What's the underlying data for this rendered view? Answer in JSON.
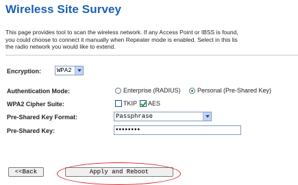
{
  "page": {
    "title": "Wireless Site Survey",
    "description_lines": [
      "This page provides tool to scan the wireless network. If any Access Point or IBSS is found,",
      "you could choose to connect it manually when Repeater mode is enabled. Select in this lis",
      "the radio network you would like to extend."
    ]
  },
  "form": {
    "encryption": {
      "label": "Encryption:",
      "value": "WPA2"
    },
    "auth_mode": {
      "label": "Authentication Mode:",
      "options": [
        {
          "label": "Enterprise (RADIUS)",
          "selected": false
        },
        {
          "label": "Personal (Pre-Shared Key)",
          "selected": true
        }
      ]
    },
    "cipher_suite": {
      "label": "WPA2 Cipher Suite:",
      "options": [
        {
          "label": "TKIP",
          "checked": false
        },
        {
          "label": "AES",
          "checked": true
        }
      ]
    },
    "psk_format": {
      "label": "Pre-Shared Key Format:",
      "value": "Passphrase"
    },
    "psk": {
      "label": "Pre-Shared Key:",
      "value": "••••••••"
    }
  },
  "buttons": {
    "back_label": "<<Back",
    "apply_label": "Apply and Reboot"
  },
  "colors": {
    "title": "#1a5fb4",
    "highlight_ellipse": "#d62020"
  }
}
